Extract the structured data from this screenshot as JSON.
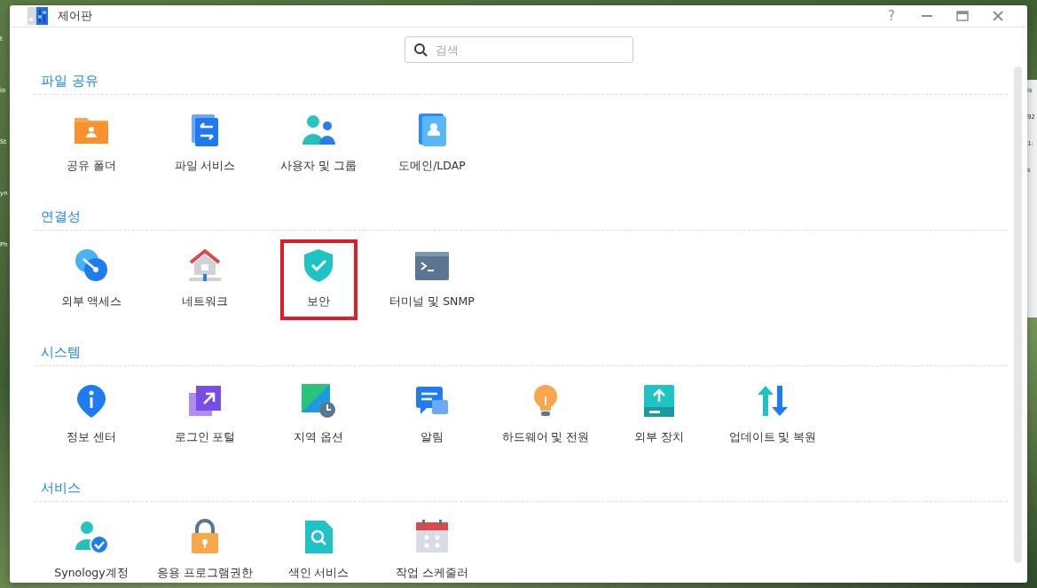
{
  "window": {
    "title": "제어판",
    "controls": [
      "?"
    ]
  },
  "search": {
    "placeholder": "검색"
  },
  "sections": [
    {
      "title": "파일 공유",
      "items": [
        {
          "label": "공유 폴더",
          "selected": false
        },
        {
          "label": "파일 서비스",
          "selected": false
        },
        {
          "label": "사용자 및 그룹",
          "selected": false
        },
        {
          "label": "도메인/LDAP",
          "selected": false
        }
      ]
    },
    {
      "title": "연결성",
      "items": [
        {
          "label": "외부 액세스",
          "selected": false
        },
        {
          "label": "네트워크",
          "selected": false
        },
        {
          "label": "보안",
          "selected": true
        },
        {
          "label": "터미널 및 SNMP",
          "selected": false
        }
      ]
    },
    {
      "title": "시스템",
      "items": [
        {
          "label": "정보 센터",
          "selected": false
        },
        {
          "label": "로그인 포털",
          "selected": false
        },
        {
          "label": "지역 옵션",
          "selected": false
        },
        {
          "label": "알림",
          "selected": false
        },
        {
          "label": "하드웨어 및 전원",
          "selected": false
        },
        {
          "label": "외부 장치",
          "selected": false
        },
        {
          "label": "업데이트 및 복원",
          "selected": false
        }
      ]
    },
    {
      "title": "서비스",
      "items": [
        {
          "label": "Synology계정",
          "selected": false
        },
        {
          "label": "응용 프로그램권한",
          "selected": false
        },
        {
          "label": "색인 서비스",
          "selected": false
        },
        {
          "label": "작업 스케줄러",
          "selected": false
        }
      ]
    }
  ],
  "desktop": {
    "left_labels": [
      "t",
      "io",
      "St",
      "yn",
      "Ph"
    ],
    "right_labels": [
      "is",
      "92",
      "1:",
      "s"
    ]
  }
}
